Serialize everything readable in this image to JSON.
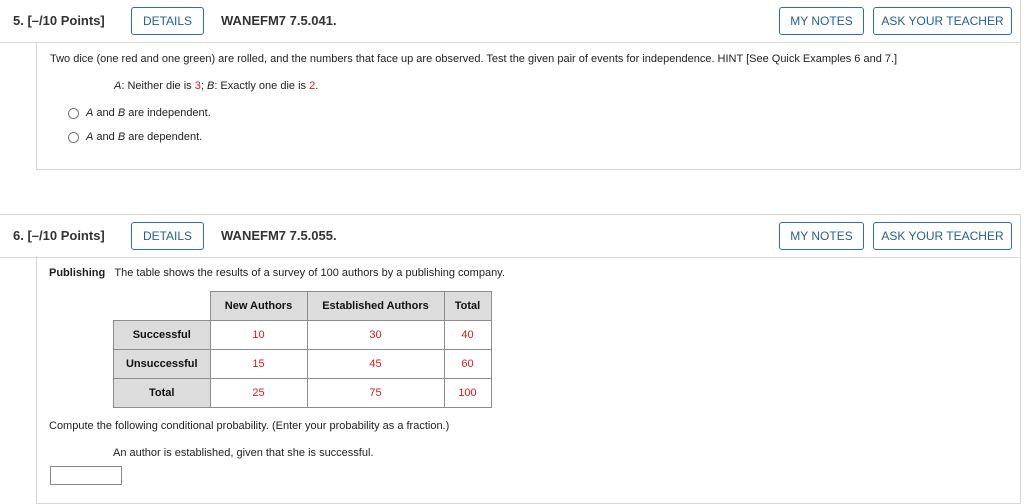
{
  "q5": {
    "number": "5.",
    "points": "[–/10 Points]",
    "details_label": "DETAILS",
    "id": "WANEFM7 7.5.041.",
    "my_notes_label": "MY NOTES",
    "ask_label": "ASK YOUR TEACHER",
    "prompt": "Two dice (one red and one green) are rolled, and the numbers that face up are observed. Test the given pair of events for independence. HINT [See Quick Examples 6 and 7.]",
    "events": {
      "a_label": "A",
      "a_text": ": Neither die is ",
      "a_value": "3",
      "sep": "; ",
      "b_label": "B",
      "b_text": ": Exactly one die is ",
      "b_value": "2",
      "end": "."
    },
    "options": [
      {
        "a": "A",
        "mid": " and ",
        "b": "B",
        "rest": " are independent."
      },
      {
        "a": "A",
        "mid": " and ",
        "b": "B",
        "rest": " are dependent."
      }
    ]
  },
  "q6": {
    "number": "6.",
    "points": "[–/10 Points]",
    "details_label": "DETAILS",
    "id": "WANEFM7 7.5.055.",
    "my_notes_label": "MY NOTES",
    "ask_label": "ASK YOUR TEACHER",
    "topic": "Publishing",
    "prompt": "The table shows the results of a survey of 100 authors by a publishing company.",
    "table": {
      "columns": [
        "New Authors",
        "Established Authors",
        "Total"
      ],
      "rows": [
        {
          "label": "Successful",
          "values": [
            "10",
            "30",
            "40"
          ]
        },
        {
          "label": "Unsuccessful",
          "values": [
            "15",
            "45",
            "60"
          ]
        },
        {
          "label": "Total",
          "values": [
            "25",
            "75",
            "100"
          ]
        }
      ]
    },
    "instruction": "Compute the following conditional probability. (Enter your probability as a fraction.)",
    "subquestion": "An author is established, given that she is successful.",
    "answer_value": ""
  }
}
